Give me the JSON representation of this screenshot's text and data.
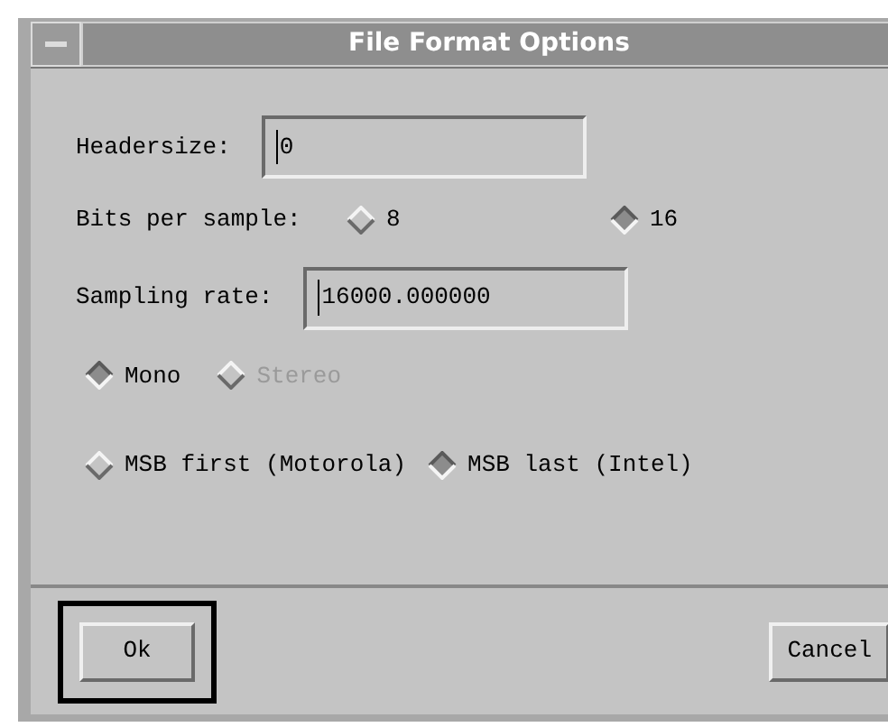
{
  "window": {
    "title": "File Format Options"
  },
  "headersize": {
    "label": "Headersize:",
    "value": "0"
  },
  "bits_per_sample": {
    "label": "Bits per sample:",
    "options": [
      {
        "label": "8",
        "selected": false,
        "disabled": false
      },
      {
        "label": "16",
        "selected": true,
        "disabled": false
      }
    ]
  },
  "sampling_rate": {
    "label": "Sampling rate:",
    "value": "16000.000000"
  },
  "channels": [
    {
      "label": "Mono",
      "selected": true,
      "disabled": false
    },
    {
      "label": "Stereo",
      "selected": false,
      "disabled": true
    }
  ],
  "byte_order": [
    {
      "label": "MSB first (Motorola)",
      "selected": false,
      "disabled": false
    },
    {
      "label": "MSB last (Intel)",
      "selected": true,
      "disabled": false
    }
  ],
  "buttons": [
    {
      "label": "Ok",
      "default": true
    },
    {
      "label": "Cancel",
      "default": false
    }
  ]
}
